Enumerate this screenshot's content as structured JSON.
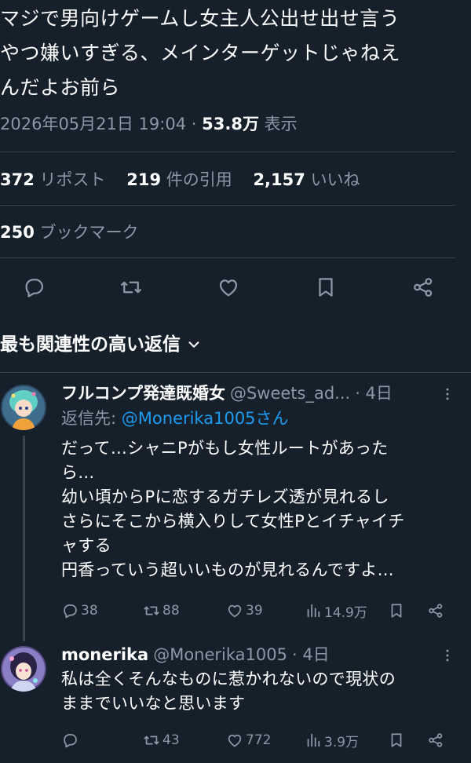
{
  "main_tweet": {
    "text": "マジで男向けゲームし女主人公出せ出せ言う\nやつ嫌いすぎる、メインターゲットじゃねえ\nんだよお前ら",
    "date": "2026年05月21日 19:04",
    "separator": "·",
    "views_count": "53.8万",
    "views_label": "表示"
  },
  "stats": {
    "reposts_count": "372",
    "reposts_label": "リポスト",
    "quotes_count": "219",
    "quotes_label": "件の引用",
    "likes_count": "2,157",
    "likes_label": "いいね",
    "bookmarks_count": "250",
    "bookmarks_label": "ブックマーク"
  },
  "actions": [
    "reply-icon",
    "repost-icon",
    "like-icon",
    "bookmark-icon",
    "share-icon"
  ],
  "sort": {
    "label": "最も関連性の高い返信"
  },
  "replies": [
    {
      "name": "フルコンプ発達既婚女",
      "handle": "@Sweets_ad...",
      "time": "· 4日",
      "reply_to_label": "返信先:",
      "reply_to_handle": "@Monerika1005さん",
      "text": "だって…シャニPがもし女性ルートがあった\nら…\n幼い頃からPに恋するガチレズ透が見れるし\nさらにそこから横入りして女性Pとイチャイチ\nャする\n円香っていう超いいものが見れるんですよ…",
      "replies": "38",
      "reposts": "88",
      "likes": "39",
      "views": "14.9万"
    },
    {
      "name": "monerika",
      "handle": "@Monerika1005",
      "time": "· 4日",
      "text": "私は全くそんなものに惹かれないので現状の\nままでいいなと思います",
      "replies": "",
      "reposts": "43",
      "likes": "772",
      "views": "3.9万"
    }
  ],
  "colors": {
    "background": "#15202b",
    "text_primary": "#ffffff",
    "text_secondary": "#8b98a5",
    "accent": "#1d9bf0",
    "divider": "#38444d"
  }
}
